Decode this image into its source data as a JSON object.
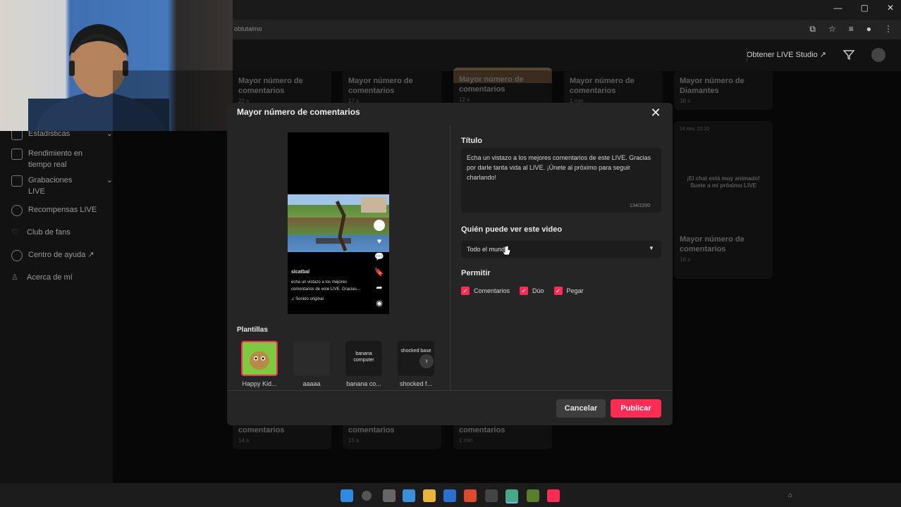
{
  "browser": {
    "address": "obtutalmo",
    "window_controls": [
      "—",
      "▢",
      "✕"
    ]
  },
  "header": {
    "studio_link": "Obtener LIVE Studio ↗"
  },
  "sidebar": {
    "items": [
      {
        "label": "Estadísticas",
        "icon": "chart-icon"
      },
      {
        "label": "Rendimiento en tiempo real",
        "icon": "monitor-icon"
      },
      {
        "label": "Grabaciones LIVE",
        "icon": "recording-icon"
      },
      {
        "label": "Recompensas LIVE",
        "icon": "reward-icon"
      },
      {
        "label": "Club de fans",
        "icon": "heart-icon"
      },
      {
        "label": "Centro de ayuda ↗",
        "icon": "help-icon"
      },
      {
        "label": "Acerca de mí",
        "icon": "user-icon"
      }
    ]
  },
  "grid": {
    "top_cards": [
      {
        "title": "Mayor número de comentarios",
        "meta": "22 s"
      },
      {
        "title": "Mayor número de comentarios",
        "meta": "17 s"
      },
      {
        "title": "Mayor número de comentarios",
        "meta": "12 s"
      },
      {
        "title": "Mayor número de comentarios",
        "meta": "1 min"
      },
      {
        "title": "Mayor número de Diamantes",
        "meta": "38 s"
      }
    ],
    "right_card": {
      "date": "14 nov, 20:10",
      "overlay": "¡El chat está muy animado! Suete a mi próximo LIVE",
      "title": "Mayor número de comentarios",
      "meta": "16 s"
    },
    "bottom_cards": [
      {
        "title": "comentarios",
        "meta": "14 s"
      },
      {
        "title": "comentarios",
        "meta": "15 s"
      },
      {
        "title": "comentarios",
        "meta": "1 min"
      }
    ]
  },
  "modal": {
    "title": "Mayor número de comentarios",
    "close": "✕",
    "preview": {
      "username": "slcatbal",
      "caption": "echa un vistazo a los mejores comentarios de este LIVE. Gracias...",
      "sound": "♫ Sonido original"
    },
    "title_label": "Título",
    "title_value": "Echa un vistazo a los mejores comentarios de este LIVE. Gracias por darle tanta vida al LIVE. ¡Únete al próximo para seguir charlando!",
    "title_count": "134/2200",
    "who_label": "Quién puede ver este video",
    "who_value": "Todo el mundo",
    "allow_label": "Permitir",
    "allow_options": [
      "Comentarios",
      "Dúo",
      "Pegar"
    ],
    "templates_label": "Plantillas",
    "templates": [
      {
        "thumb": "",
        "label": "Happy Kid..."
      },
      {
        "thumb": "",
        "label": "aaaaa"
      },
      {
        "thumb": "banana computer",
        "label": "banana co..."
      },
      {
        "thumb": "shocked base",
        "label": "shocked f..."
      }
    ],
    "cancel": "Cancelar",
    "publish": "Publicar"
  },
  "colors": {
    "accent": "#fe2c55",
    "modal_bg": "#252525",
    "page_bg": "#0b0b0b"
  }
}
